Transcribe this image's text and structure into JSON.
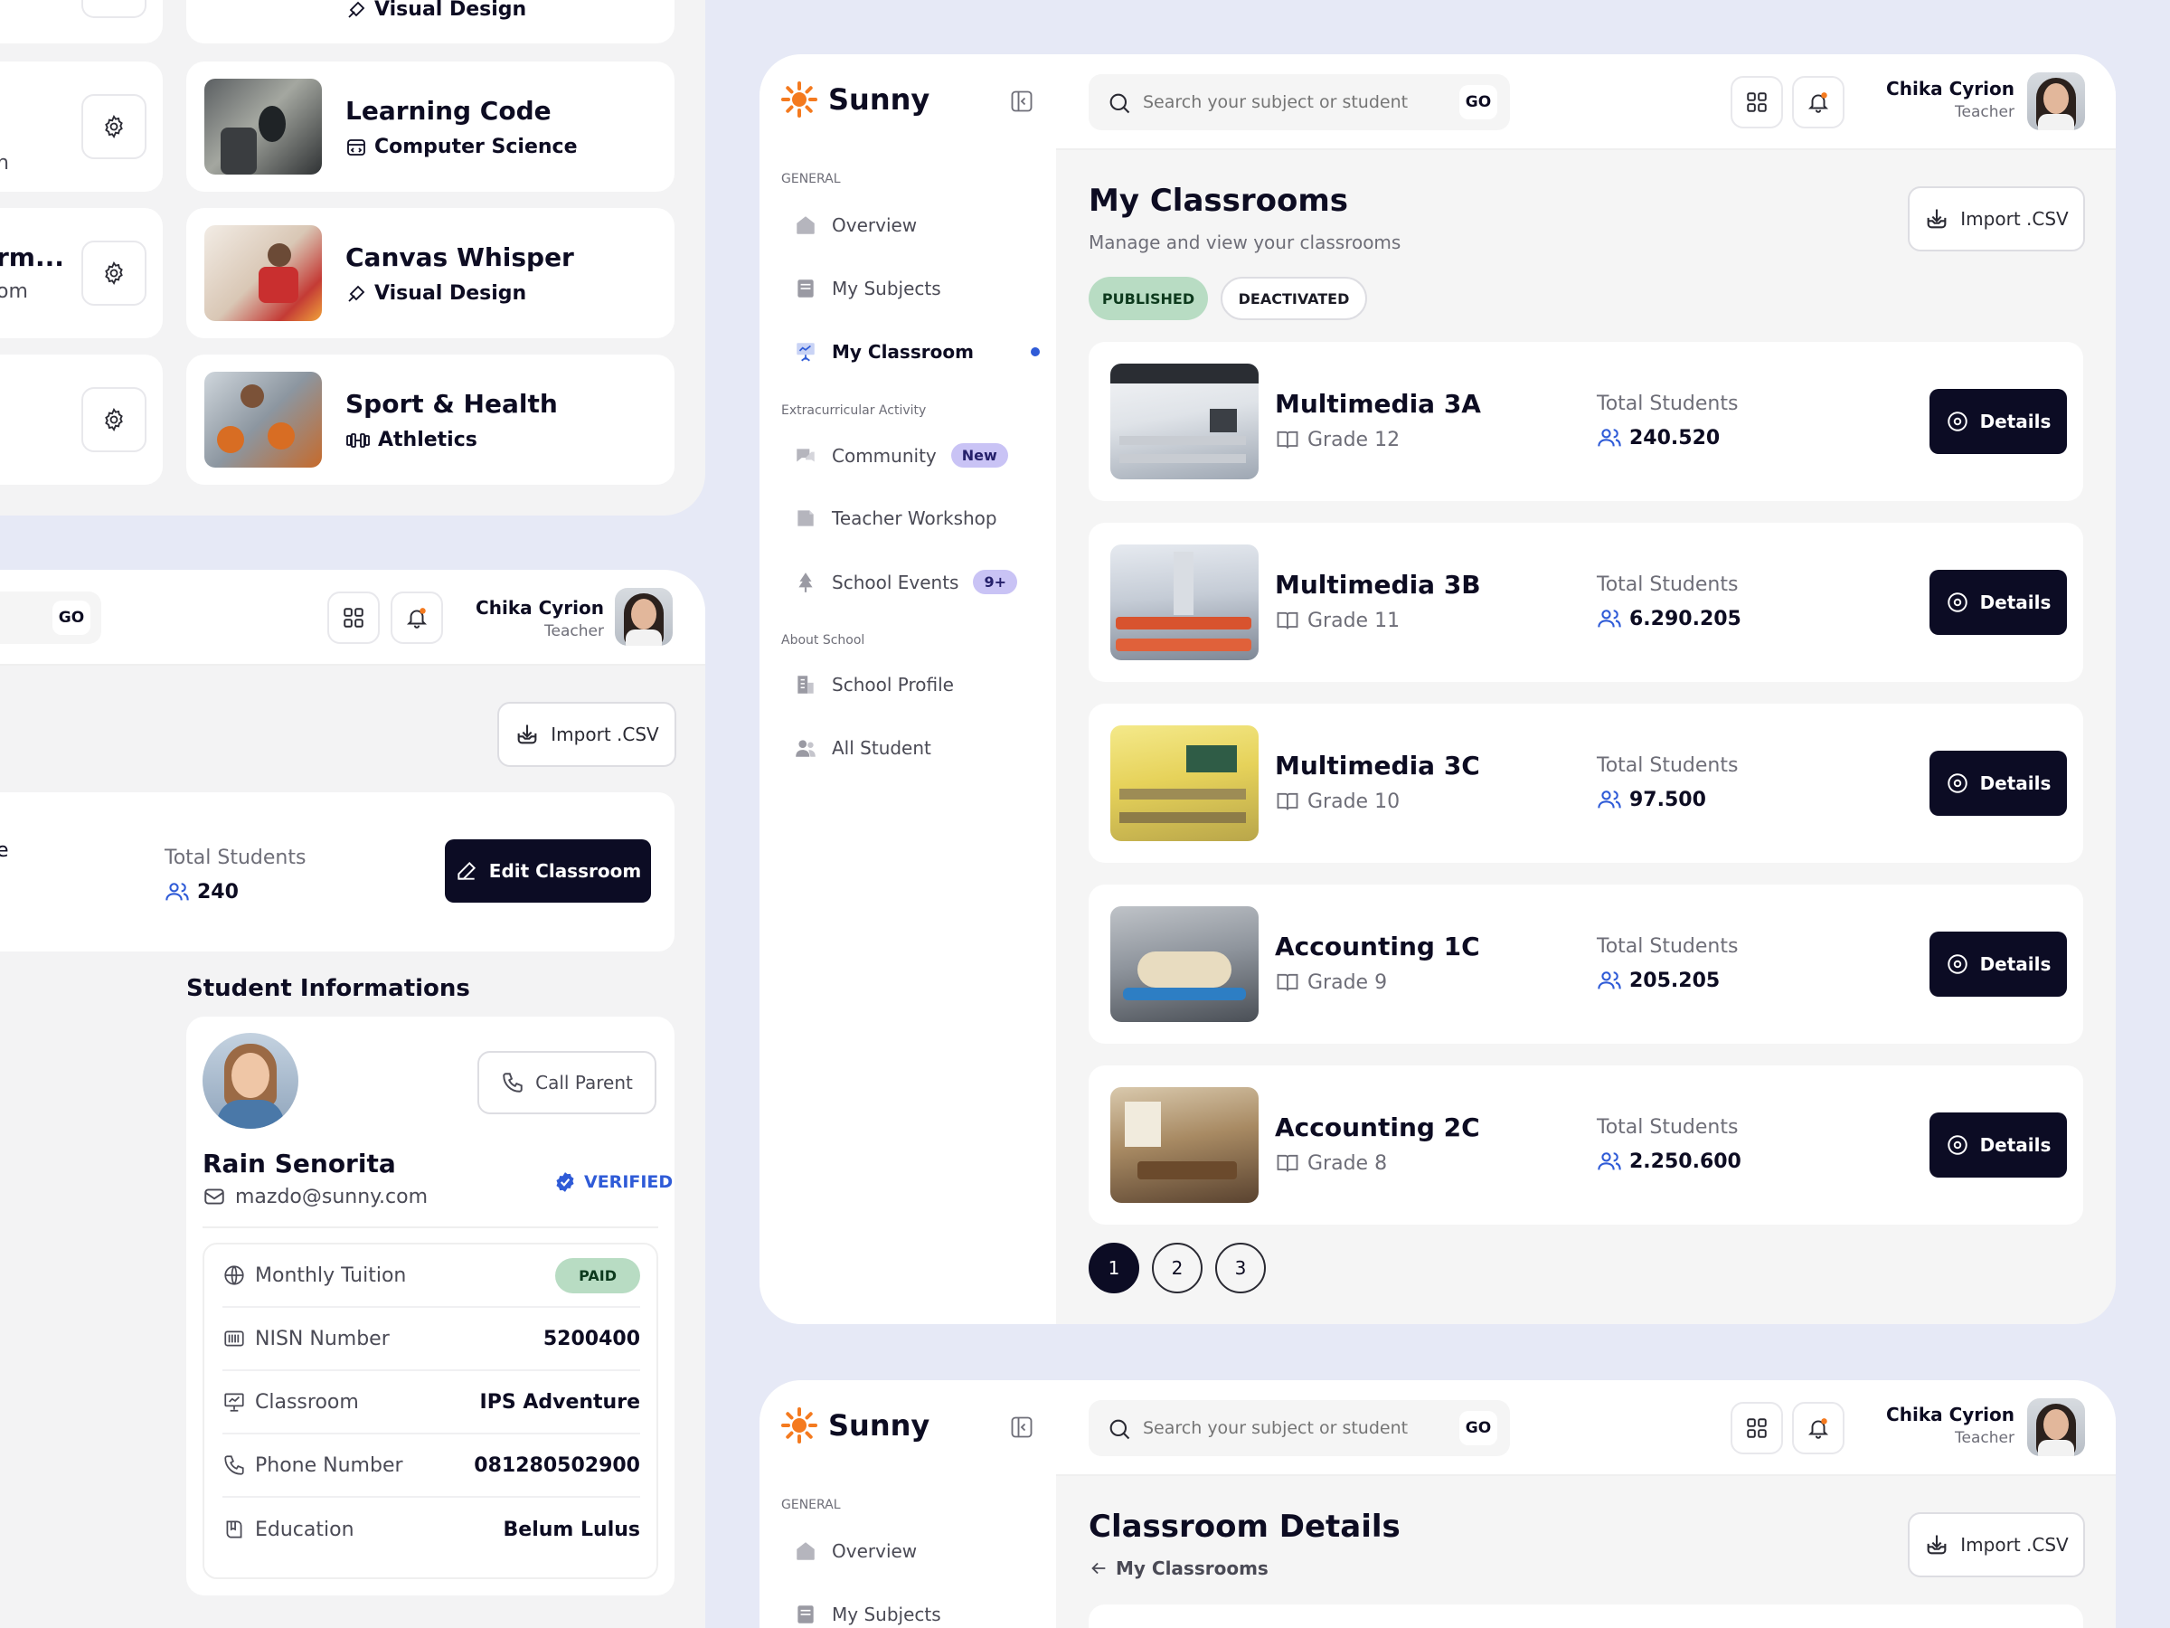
{
  "colors": {
    "background": "#e6e9f6",
    "accent_dark": "#0c0c24",
    "accent_blue": "#2f5bd7",
    "badge_purple": "#c9c3f5",
    "green_pill": "#b8dcc3",
    "logo_orange": "#f47a1f"
  },
  "left_top": {
    "subjects": [
      {
        "title": "",
        "subtitle": "Visual Design",
        "icon": "brush-icon"
      },
      {
        "title": "Learning Code",
        "subtitle": "Computer Science",
        "icon": "code-window-icon"
      },
      {
        "title": "Canvas Whisper",
        "subtitle": "Visual Design",
        "icon": "brush-icon"
      },
      {
        "title": "Sport & Health",
        "subtitle": "Athletics",
        "icon": "dumbbell-icon"
      }
    ],
    "gear_cards": [
      {
        "text_a": "n",
        "text_b": ""
      },
      {
        "text_a": "rm...",
        "text_b": "om"
      },
      {
        "text_a": "",
        "text_b": ""
      }
    ]
  },
  "left_bottom": {
    "go_label": "GO",
    "user_name": "Chika Cyrion",
    "user_role": "Teacher",
    "import_label": "Import .CSV",
    "summary": {
      "partial_text": "e",
      "total_label": "Total Students",
      "total_value": "240",
      "edit_label": "Edit Classroom"
    },
    "student_section_title": "Student Informations",
    "student": {
      "name": "Rain Senorita",
      "email": "mazdo@sunny.com",
      "verified_label": "VERIFIED",
      "call_parent_label": "Call Parent",
      "rows": [
        {
          "label": "Monthly Tuition",
          "value": "PAID",
          "icon": "globe-icon"
        },
        {
          "label": "NISN Number",
          "value": "5200400",
          "icon": "barcode-icon"
        },
        {
          "label": "Classroom",
          "value": "IPS Adventure",
          "icon": "presentation-icon"
        },
        {
          "label": "Phone Number",
          "value": "081280502900",
          "icon": "phone-icon"
        },
        {
          "label": "Education",
          "value": "Belum Lulus",
          "icon": "book-icon"
        }
      ]
    }
  },
  "main": {
    "brand": "Sunny",
    "search_placeholder": "Search your subject or student",
    "go_label": "GO",
    "user_name": "Chika Cyrion",
    "user_role": "Teacher",
    "sidebar": {
      "sections": [
        {
          "label": "GENERAL"
        },
        {
          "label": "Extracurricular Activity"
        },
        {
          "label": "About School"
        }
      ],
      "items": [
        {
          "label": "Overview",
          "icon": "home-icon"
        },
        {
          "label": "My Subjects",
          "icon": "book-stack-icon"
        },
        {
          "label": "My Classroom",
          "icon": "classroom-board-icon"
        },
        {
          "label": "Community",
          "icon": "chat-bubbles-icon",
          "badge": "New"
        },
        {
          "label": "Teacher Workshop",
          "icon": "workshop-icon"
        },
        {
          "label": "School Events",
          "icon": "tree-icon",
          "badge": "9+"
        },
        {
          "label": "School Profile",
          "icon": "building-icon"
        },
        {
          "label": "All Student",
          "icon": "students-icon"
        }
      ]
    },
    "page_title": "My Classrooms",
    "page_subtitle": "Manage and view your classrooms",
    "import_label": "Import .CSV",
    "filters": {
      "published": "PUBLISHED",
      "deactivated": "DEACTIVATED"
    },
    "total_label": "Total Students",
    "details_label": "Details",
    "classrooms": [
      {
        "name": "Multimedia 3A",
        "grade": "Grade 12",
        "total": "240.520"
      },
      {
        "name": "Multimedia 3B",
        "grade": "Grade 11",
        "total": "6.290.205"
      },
      {
        "name": "Multimedia 3C",
        "grade": "Grade 10",
        "total": "97.500"
      },
      {
        "name": "Accounting 1C",
        "grade": "Grade 9",
        "total": "205.205"
      },
      {
        "name": "Accounting 2C",
        "grade": "Grade 8",
        "total": "2.250.600"
      }
    ],
    "pagination": [
      "1",
      "2",
      "3"
    ]
  },
  "second": {
    "brand": "Sunny",
    "search_placeholder": "Search your subject or student",
    "go_label": "GO",
    "user_name": "Chika Cyrion",
    "user_role": "Teacher",
    "section_label": "GENERAL",
    "items": [
      {
        "label": "Overview"
      },
      {
        "label": "My Subjects"
      }
    ],
    "page_title": "Classroom Details",
    "back_label": "My Classrooms",
    "import_label": "Import .CSV"
  }
}
